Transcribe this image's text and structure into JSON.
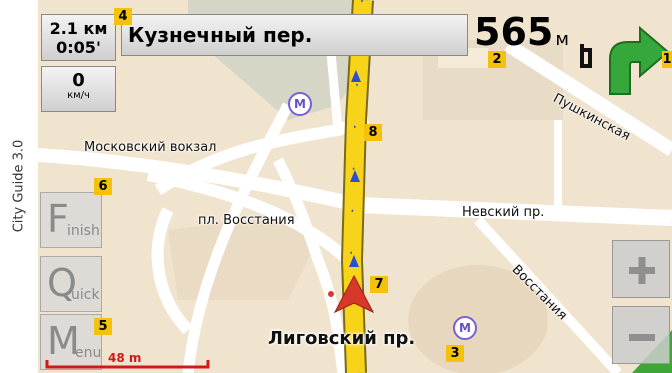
{
  "side_caption": "City Guide 3.0",
  "nav": {
    "distance_remaining": "2.1 км",
    "time_remaining": "0:05'",
    "speed_value": "0",
    "speed_unit": "км/ч",
    "current_street": "Кузнечный пер.",
    "next_turn_distance": "565",
    "next_turn_unit": "м",
    "turn_direction": "turn-right-arrow-icon"
  },
  "map": {
    "labels": {
      "station": "Московский вокзал",
      "square": "пл. Восстания",
      "nevsky": "Невский пр.",
      "pushkinskaya": "Пушкинская",
      "vosstaniya": "Восстания",
      "current_road": "Лиговский пр."
    },
    "metro_symbol": "M",
    "scale_label": "48 m"
  },
  "buttons": {
    "finish_cap": "F",
    "finish_rest": "inish",
    "quick_cap": "Q",
    "quick_rest": "uick",
    "menu_cap": "M",
    "menu_rest": "enu",
    "zoom_in": "+",
    "zoom_out": "−"
  },
  "callouts": [
    "4",
    "2",
    "1",
    "8",
    "6",
    "7",
    "5",
    "3"
  ],
  "colors": {
    "map_background": "#f1e4cf",
    "route": "#f7d31a",
    "road": "#ffffff",
    "park": "#d6d6c7",
    "turn_arrow": "#36a83b",
    "position_marker": "#d8382a",
    "callout": "#f4c20b"
  }
}
